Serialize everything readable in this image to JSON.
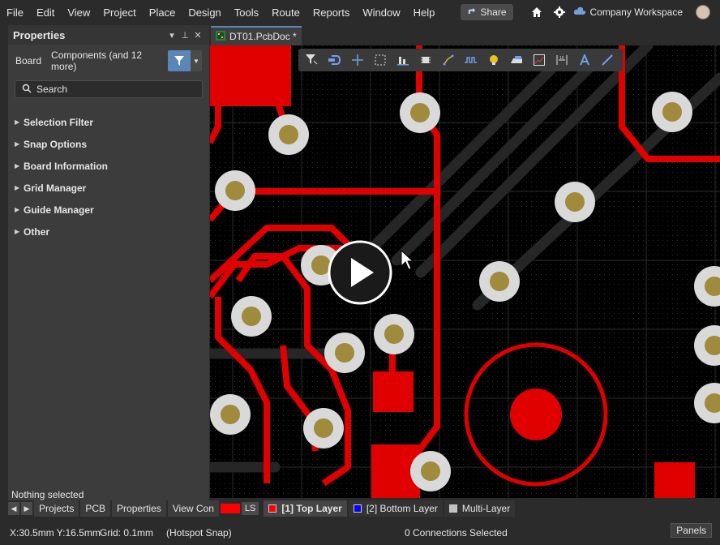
{
  "menu": [
    "File",
    "Edit",
    "View",
    "Project",
    "Place",
    "Design",
    "Tools",
    "Route",
    "Reports",
    "Window",
    "Help"
  ],
  "header": {
    "share_label": "Share",
    "workspace_label": "Company Workspace"
  },
  "panel": {
    "title": "Properties",
    "filter_board": "Board",
    "filter_components": "Components (and 12 more)",
    "search_placeholder": "Search",
    "sections": [
      "Selection Filter",
      "Snap Options",
      "Board Information",
      "Grid Manager",
      "Guide Manager",
      "Other"
    ],
    "nothing_selected": "Nothing selected"
  },
  "document": {
    "tab_label": "DT01.PcbDoc *"
  },
  "bottom_tabs": [
    "Projects",
    "PCB",
    "Properties",
    "View Con"
  ],
  "layers": {
    "ls_label": "LS",
    "items": [
      {
        "label": "[1] Top Layer",
        "color": "#ff0000"
      },
      {
        "label": "[2] Bottom Layer",
        "color": "#0000ff"
      },
      {
        "label": "Multi-Layer",
        "color": "#c0c0c0"
      }
    ]
  },
  "status": {
    "coords": "X:30.5mm Y:16.5mm",
    "grid": "Grid: 0.1mm",
    "snap": "(Hotspot Snap)",
    "connections": "0 Connections Selected",
    "panels_label": "Panels"
  },
  "colors": {
    "accent": "#5a87b8",
    "copper_top": "#e00000",
    "pad_ring": "#d9d9d9",
    "pad_hole": "#a08a3c"
  }
}
